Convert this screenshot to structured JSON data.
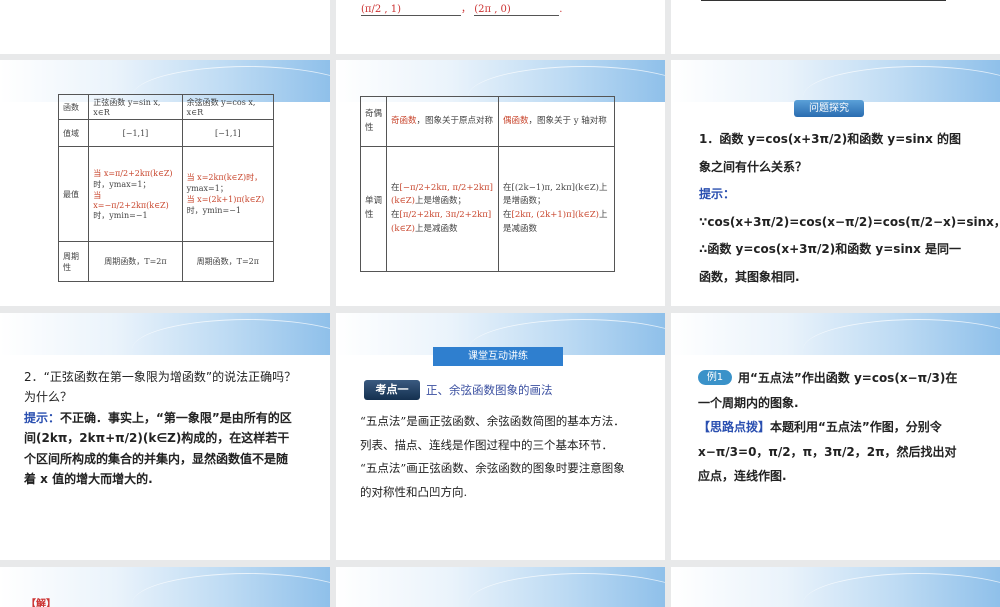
{
  "slide_top_mid": {
    "frac1": "(π/2 , 1)",
    "frac2": "(2π , 0)"
  },
  "table1": {
    "h0": "函数",
    "h1": "正弦函数 y=sin x, x∈R",
    "h2": "余弦函数 y=cos x, x∈R",
    "r1": "值域",
    "r1a": "[−1,1]",
    "r1b": "[−1,1]",
    "r2": "最值",
    "r2a1": "当 x=π/2+2kπ(k∈Z)",
    "r2a2": "时，ymax=1；",
    "r2a3": "当 x=−π/2+2kπ(k∈Z)",
    "r2a4": "时，ymin=−1",
    "r2b1": "当 x=2kπ(k∈Z)时，",
    "r2b2": "ymax=1；",
    "r2b3": "当 x=(2k+1)π(k∈Z)",
    "r2b4": "时，ymin=−1",
    "r3": "周期性",
    "r3a": "周期函数，T=2π",
    "r3b": "周期函数，T=2π"
  },
  "table2": {
    "r1": "奇偶性",
    "r1a_red": "奇函数",
    "r1a": "，图象关于原点对称",
    "r1b_red": "偶函数",
    "r1b": "，图象关于 y 轴对称",
    "r2": "单调性",
    "r2a1": "在",
    "r2a1r": "[−π/2+2kπ, π/2+2kπ](k∈Z)",
    "r2a2": "上是增函数；",
    "r2a3": "在",
    "r2a3r": "[π/2+2kπ, 3π/2+2kπ](k∈Z)",
    "r2a4": "上是减函数",
    "r2b1": "在[(2k−1)π, 2kπ](k∈Z)上是增函数；",
    "r2b2": "在",
    "r2b2r": "[2kπ, (2k+1)π](k∈Z)",
    "r2b3": "上是减函数"
  },
  "explore": {
    "tag": "问题探究",
    "q": "1．函数 y=cos(x+3π/2)和函数 y=sinx 的图象之间有什么关系？",
    "hint_label": "提示：",
    "hint": "∵cos(x+3π/2)=cos(x−π/2)=cos(π/2−x)=sinx，∴函数 y=cos(x+3π/2)和函数 y=sinx 是同一函数，其图象相同."
  },
  "q2": {
    "q": "2．“正弦函数在第一象限为增函数”的说法正确吗？为什么？",
    "hint_label": "提示：",
    "hint": "不正确．事实上，“第一象限”是由所有的区间(2kπ，2kπ+π/2)(k∈Z)构成的，在这样若干个区间所构成的集合的并集内，显然函数值不是随着 x 值的增大而增大的."
  },
  "practice": {
    "tag": "课堂互动讲练",
    "point_tag": "考点一",
    "point_title": "正、余弦函数图象的画法",
    "p1": "“五点法”是画正弦函数、余弦函数简图的基本方法．列表、描点、连线是作图过程中的三个基本环节．",
    "p2": "“五点法”画正弦函数、余弦函数的图象时要注意图象的对称性和凸凹方向."
  },
  "example": {
    "badge": "例1",
    "q": "用“五点法”作出函数 y=cos(x−π/3)在一个周期内的图象.",
    "hint_label": "【思路点拨】",
    "hint": "本题利用“五点法”作图，分别令 x−π/3=0，π/2，π，3π/2，2π，然后找出对应点，连线作图."
  },
  "bottom": {
    "label": "【解】"
  }
}
